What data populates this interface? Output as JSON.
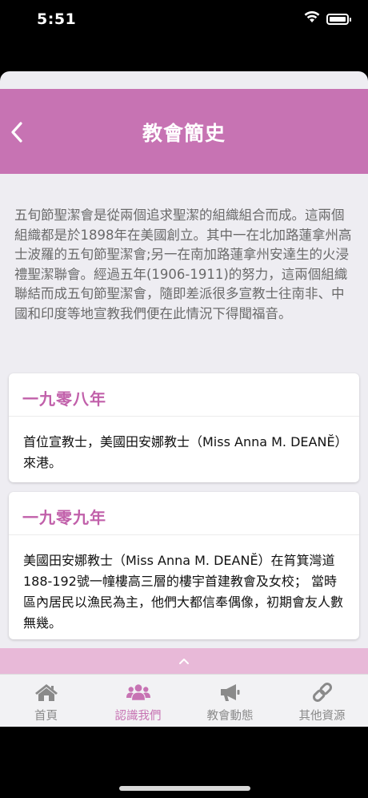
{
  "status_bar": {
    "time": "5:51",
    "icons": [
      "wifi-icon",
      "battery-icon"
    ]
  },
  "header": {
    "title": "教會簡史",
    "back_icon": "chevron-left-icon",
    "color": "#c773b3"
  },
  "intro": {
    "text": "五旬節聖潔會是從兩個追求聖潔的組織組合而成。這兩個組織都是於1898年在美國創立。其中一在北加路蓮拿州高士波羅的五旬節聖潔會;另一在南加路蓮拿州安達生的火浸禮聖潔聯會。經過五年(1906-1911)的努力，這兩個組織聯結而成五旬節聖潔會，隨即差派很多宣教士往南非、中國和印度等地宣教我們便在此情況下得聞福音。"
  },
  "timeline": [
    {
      "year": "一九零八年",
      "text": "首位宣教士，美國田安娜教士（Miss Anna M. DEANĔ）來港。"
    },
    {
      "year": "一九零九年",
      "text": "美國田安娜教士（Miss Anna M. DEANĔ）在筲箕灣道188-192號一幢樓高三層的樓宇首建教會及女校； 當時區內居民以漁民為主，他們大都信奉偶像，初期會友人數無幾。"
    }
  ],
  "collapse_icon": "chevron-up-icon",
  "tabs": [
    {
      "label": "首頁",
      "icon": "home-icon",
      "active": false
    },
    {
      "label": "認識我們",
      "icon": "users-icon",
      "active": true
    },
    {
      "label": "教會動態",
      "icon": "megaphone-icon",
      "active": false
    },
    {
      "label": "其他資源",
      "icon": "link-icon",
      "active": false
    }
  ],
  "colors": {
    "accent": "#c773b3",
    "accent_text": "#c160aa",
    "collapse_bar": "#e8b9d8",
    "background": "#eeedf2"
  }
}
